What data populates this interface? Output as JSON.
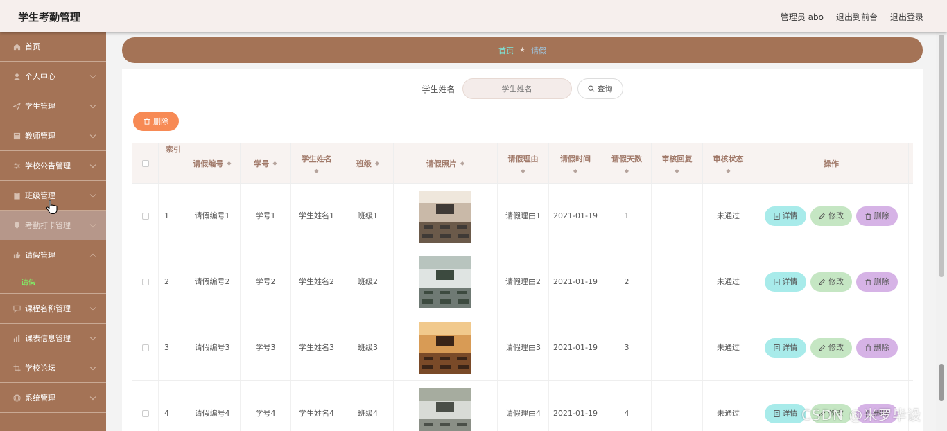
{
  "header": {
    "app_title": "学生考勤管理",
    "admin": "管理员 abo",
    "front_link": "退出到前台",
    "logout": "退出登录"
  },
  "sidebar": {
    "items": [
      {
        "label": "首页",
        "icon": "home-icon"
      },
      {
        "label": "个人中心",
        "icon": "user-icon"
      },
      {
        "label": "学生管理",
        "icon": "send-icon"
      },
      {
        "label": "教师管理",
        "icon": "list-icon"
      },
      {
        "label": "学校公告管理",
        "icon": "sliders-icon"
      },
      {
        "label": "班级管理",
        "icon": "clipboard-icon"
      },
      {
        "label": "考勤打卡管理",
        "icon": "location-icon"
      },
      {
        "label": "请假管理",
        "icon": "thumb-icon"
      },
      {
        "label": "课程名称管理",
        "icon": "chat-icon"
      },
      {
        "label": "课表信息管理",
        "icon": "chart-icon"
      },
      {
        "label": "学校论坛",
        "icon": "crop-icon"
      },
      {
        "label": "系统管理",
        "icon": "globe-icon"
      }
    ],
    "submenu_leave": "请假"
  },
  "breadcrumb": {
    "home": "首页",
    "separator": "★",
    "current": "请假"
  },
  "search": {
    "label": "学生姓名",
    "placeholder": "学生姓名",
    "button": "查询"
  },
  "toolbar": {
    "delete": "删除"
  },
  "table": {
    "headers": {
      "index": "索引",
      "leave_no": "请假编号",
      "student_id": "学号",
      "student_name": "学生姓名",
      "class": "班级",
      "photo": "请假照片",
      "reason": "请假理由",
      "time": "请假时间",
      "days": "请假天数",
      "reply": "审核回复",
      "status": "审核状态",
      "actions": "操作"
    },
    "rows": [
      {
        "index": "1",
        "leave_no": "请假编号1",
        "student_id": "学号1",
        "student_name": "学生姓名1",
        "class": "班级1",
        "reason": "请假理由1",
        "time": "2021-01-19",
        "days": "1",
        "reply": "",
        "status": "未通过"
      },
      {
        "index": "2",
        "leave_no": "请假编号2",
        "student_id": "学号2",
        "student_name": "学生姓名2",
        "class": "班级2",
        "reason": "请假理由2",
        "time": "2021-01-19",
        "days": "2",
        "reply": "",
        "status": "未通过"
      },
      {
        "index": "3",
        "leave_no": "请假编号3",
        "student_id": "学号3",
        "student_name": "学生姓名3",
        "class": "班级3",
        "reason": "请假理由3",
        "time": "2021-01-19",
        "days": "3",
        "reply": "",
        "status": "未通过"
      },
      {
        "index": "4",
        "leave_no": "请假编号4",
        "student_id": "学号4",
        "student_name": "学生姓名4",
        "class": "班级4",
        "reason": "请假理由4",
        "time": "2021-01-19",
        "days": "4",
        "reply": "",
        "status": "未通过"
      }
    ],
    "actions": {
      "detail": "详情",
      "edit": "修改",
      "delete": "删除"
    }
  },
  "watermark": "CSDN @米罗毕设",
  "colors": {
    "sidebar": "#a47356",
    "header": "#f6efed",
    "accent_delete": "#f78a55",
    "detail_btn": "#a8ebea",
    "edit_btn": "#c5e6c3",
    "delete_btn": "#d6b3e6",
    "submenu_active": "#7dfc6a"
  }
}
